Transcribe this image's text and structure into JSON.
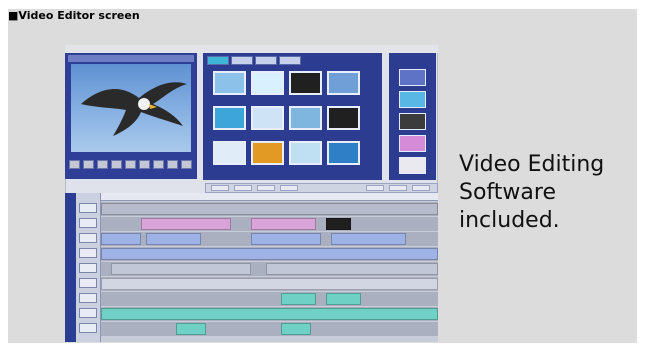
{
  "caption": "■Video Editor screen",
  "tagline": {
    "line1": "Video Editing",
    "line2": "Software",
    "line3": "included."
  },
  "colors": {
    "panel_bg": "#dcdcdc",
    "app_frame": "#2c3c91",
    "timeline_pink": "#d9a4d8",
    "timeline_blue": "#9fb2e6",
    "timeline_teal": "#6fd0c6"
  },
  "icons": {
    "preview_controls": [
      "rewind-icon",
      "step-back-icon",
      "play-icon",
      "stop-icon",
      "step-forward-icon",
      "fast-forward-icon",
      "loop-icon",
      "record-icon",
      "settings-icon"
    ],
    "track_headers": [
      "film-icon",
      "film-icon",
      "camera-icon",
      "camera-icon",
      "music-icon",
      "music-icon",
      "text-icon",
      "text-icon",
      "audio-icon"
    ]
  }
}
